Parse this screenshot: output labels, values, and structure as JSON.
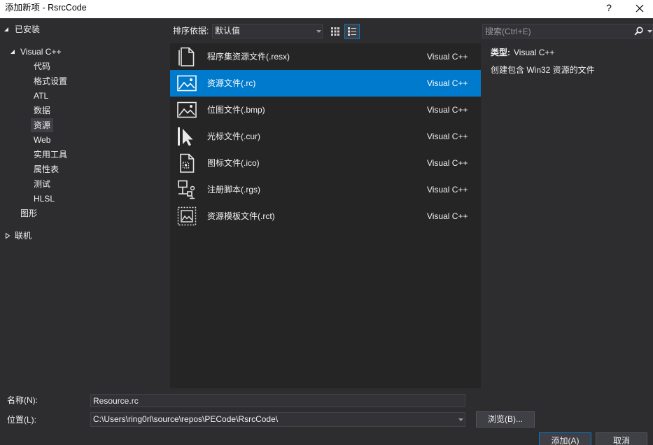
{
  "window": {
    "title": "添加新项 - RsrcCode",
    "help_label": "?"
  },
  "tree": {
    "installed": {
      "label": "已安装"
    },
    "visual_cpp": {
      "label": "Visual C++",
      "children": [
        "代码",
        "格式设置",
        "ATL",
        "数据",
        "资源",
        "Web",
        "实用工具",
        "属性表",
        "测试",
        "HLSL"
      ]
    },
    "graphics": {
      "label": "图形"
    },
    "online": {
      "label": "联机"
    }
  },
  "toolbar": {
    "sort_label": "排序依据:",
    "sort_value": "默认值",
    "search_placeholder": "搜索(Ctrl+E)"
  },
  "items": [
    {
      "name": "程序集资源文件(.resx)",
      "type": "Visual C++",
      "icon": "document-icon"
    },
    {
      "name": "资源文件(.rc)",
      "type": "Visual C++",
      "icon": "image-icon"
    },
    {
      "name": "位图文件(.bmp)",
      "type": "Visual C++",
      "icon": "image-icon"
    },
    {
      "name": "光标文件(.cur)",
      "type": "Visual C++",
      "icon": "cursor-icon"
    },
    {
      "name": "图标文件(.ico)",
      "type": "Visual C++",
      "icon": "icon-file-icon"
    },
    {
      "name": "注册脚本(.rgs)",
      "type": "Visual C++",
      "icon": "registry-script-icon"
    },
    {
      "name": "资源模板文件(.rct)",
      "type": "Visual C++",
      "icon": "resource-template-icon"
    }
  ],
  "details": {
    "type_label": "类型:",
    "type_value": "Visual C++",
    "description": "创建包含 Win32 资源的文件"
  },
  "form": {
    "name_label": "名称(N):",
    "name_value": "Resource.rc",
    "location_label": "位置(L):",
    "location_value": "C:\\Users\\ring0rl\\source\\repos\\PECode\\RsrcCode\\",
    "browse_label": "浏览(B)..."
  },
  "buttons": {
    "add_label": "添加(A)",
    "cancel_label": "取消"
  },
  "colors": {
    "accent": "#007acc",
    "background": "#2d2d30",
    "list_background": "#252526",
    "text": "#f1f1f1",
    "titlebar": "#ffffff"
  }
}
